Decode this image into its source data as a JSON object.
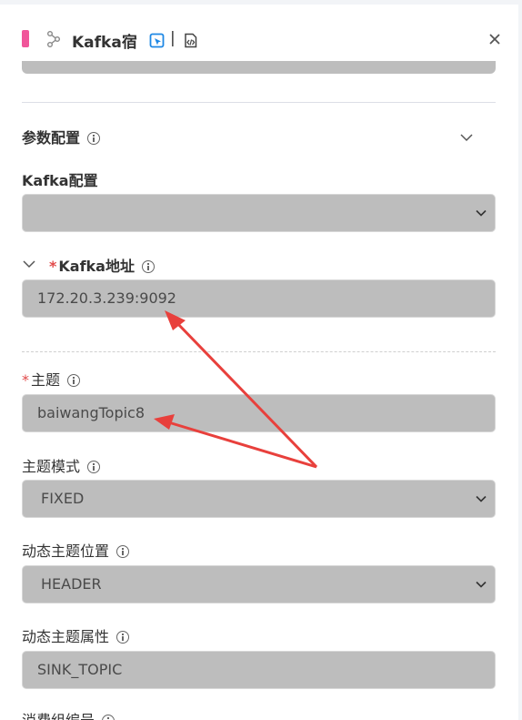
{
  "header": {
    "title": "Kafka宿",
    "separator": "|",
    "icons": [
      "node-graph-icon",
      "locate-icon",
      "code-file-icon",
      "close-icon"
    ],
    "accent_color": "#f0569a"
  },
  "section": {
    "title": "参数配置"
  },
  "fields": {
    "kafka_config": {
      "label": "Kafka配置",
      "value": ""
    },
    "kafka_address": {
      "required_mark": "*",
      "label": "Kafka地址",
      "value": "172.20.3.239:9092"
    },
    "topic": {
      "required_mark": "*",
      "label": "主题",
      "value": "baiwangTopic8"
    },
    "topic_mode": {
      "label": "主题模式",
      "value": "FIXED"
    },
    "dynamic_topic_position": {
      "label": "动态主题位置",
      "value": "HEADER"
    },
    "dynamic_topic_attribute": {
      "label": "动态主题属性",
      "value": "SINK_TOPIC"
    },
    "consumer_group": {
      "label": "消费组编号"
    }
  },
  "annotation_color": "#e8403c"
}
